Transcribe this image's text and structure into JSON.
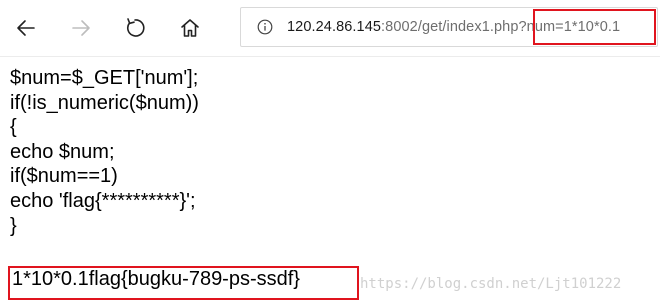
{
  "browser": {
    "nav": {
      "back_icon": "arrow-left-icon",
      "forward_icon": "arrow-right-icon",
      "refresh_icon": "refresh-icon",
      "home_icon": "home-icon"
    },
    "address_bar": {
      "info_icon": "info-icon",
      "host": "120.24.86.145",
      "path": ":8002/get/index1.php",
      "query": "?num=1*10*0.1"
    }
  },
  "page": {
    "code_lines": [
      "$num=$_GET['num'];",
      "if(!is_numeric($num))",
      "{",
      "echo $num;",
      "if($num==1)",
      "echo 'flag{**********}';",
      "}"
    ],
    "output": "1*10*0.1flag{bugku-789-ps-ssdf}"
  },
  "watermark": "https://blog.csdn.net/Ljt101222",
  "colors": {
    "highlight_box": "#e0141e",
    "url_dim": "#6e6e6e"
  }
}
